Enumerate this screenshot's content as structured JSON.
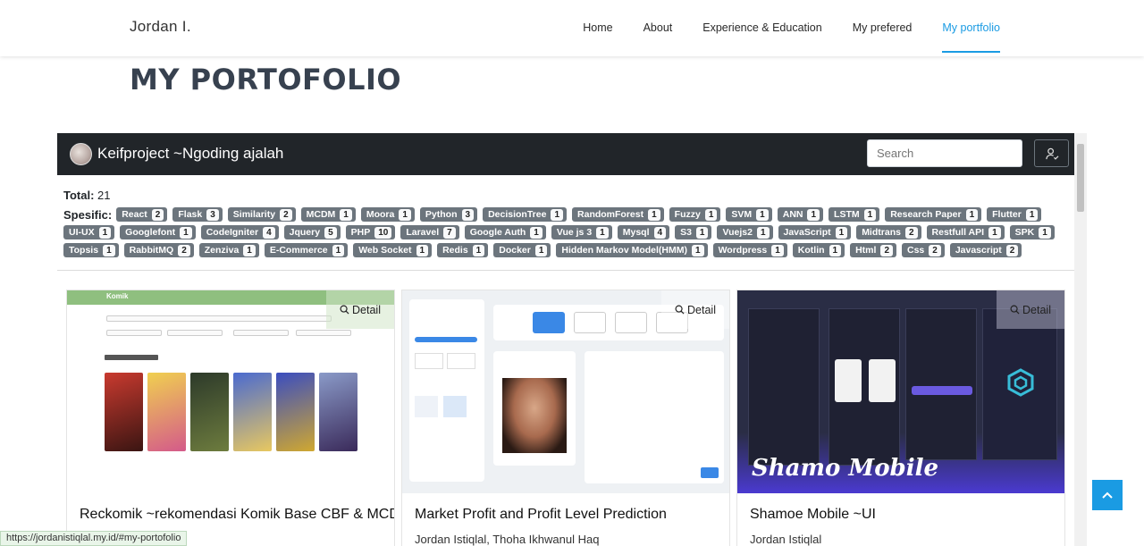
{
  "nav": {
    "brand": "Jordan I.",
    "links": [
      "Home",
      "About",
      "Experience & Education",
      "My prefered",
      "My portfolio"
    ],
    "active_index": 4
  },
  "page_title": "MY PORTOFOLIO",
  "inner": {
    "title": "Keifproject ~Ngoding ajalah",
    "search_placeholder": "Search",
    "total_label": "Total:",
    "total_value": "21",
    "specific_label": "Spesific:",
    "tags": [
      {
        "name": "React",
        "count": "2"
      },
      {
        "name": "Flask",
        "count": "3"
      },
      {
        "name": "Similarity",
        "count": "2"
      },
      {
        "name": "MCDM",
        "count": "1"
      },
      {
        "name": "Moora",
        "count": "1"
      },
      {
        "name": "Python",
        "count": "3"
      },
      {
        "name": "DecisionTree",
        "count": "1"
      },
      {
        "name": "RandomForest",
        "count": "1"
      },
      {
        "name": "Fuzzy",
        "count": "1"
      },
      {
        "name": "SVM",
        "count": "1"
      },
      {
        "name": "ANN",
        "count": "1"
      },
      {
        "name": "LSTM",
        "count": "1"
      },
      {
        "name": "Research Paper",
        "count": "1"
      },
      {
        "name": "Flutter",
        "count": "1"
      },
      {
        "name": "UI-UX",
        "count": "1"
      },
      {
        "name": "Googlefont",
        "count": "1"
      },
      {
        "name": "CodeIgniter",
        "count": "4"
      },
      {
        "name": "Jquery",
        "count": "5"
      },
      {
        "name": "PHP",
        "count": "10"
      },
      {
        "name": "Laravel",
        "count": "7"
      },
      {
        "name": "Google Auth",
        "count": "1"
      },
      {
        "name": "Vue js 3",
        "count": "1"
      },
      {
        "name": "Mysql",
        "count": "4"
      },
      {
        "name": "S3",
        "count": "1"
      },
      {
        "name": "Vuejs2",
        "count": "1"
      },
      {
        "name": "JavaScript",
        "count": "1"
      },
      {
        "name": "Midtrans",
        "count": "2"
      },
      {
        "name": "Restfull API",
        "count": "1"
      },
      {
        "name": "SPK",
        "count": "1"
      },
      {
        "name": "Topsis",
        "count": "1"
      },
      {
        "name": "RabbitMQ",
        "count": "2"
      },
      {
        "name": "Zenziva",
        "count": "1"
      },
      {
        "name": "E-Commerce",
        "count": "1"
      },
      {
        "name": "Web Socket",
        "count": "1"
      },
      {
        "name": "Redis",
        "count": "1"
      },
      {
        "name": "Docker",
        "count": "1"
      },
      {
        "name": "Hidden Markov Model(HMM)",
        "count": "1"
      },
      {
        "name": "Wordpress",
        "count": "1"
      },
      {
        "name": "Kotlin",
        "count": "1"
      },
      {
        "name": "Html",
        "count": "2"
      },
      {
        "name": "Css",
        "count": "2"
      },
      {
        "name": "Javascript",
        "count": "2"
      }
    ]
  },
  "cards": [
    {
      "title": "Reckomik ~rekomendasi Komik Base CBF & MCDM Moora",
      "authors": "",
      "detail": "Detail",
      "thumb_caption": "Komik"
    },
    {
      "title": "Market Profit and Profit Level Prediction",
      "authors": "Jordan Istiqlal, Thoha Ikhwanul Haq",
      "detail": "Detail",
      "thumb_caption": ""
    },
    {
      "title": "Shamoe Mobile ~UI",
      "authors": "Jordan Istiqlal",
      "detail": "Detail",
      "thumb_caption": "Shamo Mobile"
    }
  ],
  "status_url": "https://jordanistiqlal.my.id/#my-portofolio",
  "colors": {
    "accent": "#1a9be3",
    "navbar_dark": "#212529",
    "tag_bg": "#6c757d"
  }
}
